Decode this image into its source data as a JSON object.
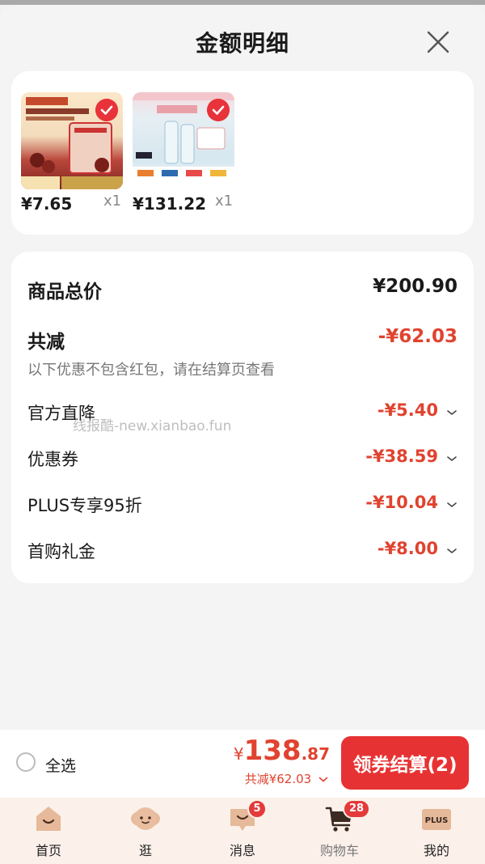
{
  "header": {
    "title": "金额明细",
    "close_icon": "close-icon"
  },
  "products": [
    {
      "price": "¥7.65",
      "qty": "x1",
      "image": "food-product-thumbnail",
      "image_colors": [
        "#8a2a22",
        "#f0d9b8"
      ],
      "selected": true
    },
    {
      "price": "¥131.22",
      "qty": "x1",
      "image": "skincare-product-thumbnail",
      "image_colors": [
        "#cfe3ee",
        "#f4c9cc"
      ],
      "selected": true
    }
  ],
  "summary": {
    "total_label": "商品总价",
    "total_value": "¥200.90",
    "discount_label": "共减",
    "discount_value": "-¥62.03",
    "note": "以下优惠不包含红包，请在结算页查看",
    "items": [
      {
        "label": "官方直降",
        "value": "-¥5.40"
      },
      {
        "label": "优惠券",
        "value": "-¥38.59"
      },
      {
        "label": "PLUS专享95折",
        "value": "-¥10.04"
      },
      {
        "label": "首购礼金",
        "value": "-¥8.00"
      }
    ]
  },
  "watermark": "线报酷-new.xianbao.fun",
  "checkout_bar": {
    "select_all": "全选",
    "currency": "¥",
    "price_int": "138",
    "price_dec": ".87",
    "reduce_text": "共减¥62.03",
    "button": "领券结算(2)"
  },
  "tabbar": {
    "tabs": [
      {
        "label": "首页",
        "icon": "home-icon"
      },
      {
        "label": "逛",
        "icon": "mascot-face-icon"
      },
      {
        "label": "消息",
        "icon": "message-icon",
        "badge": "5"
      },
      {
        "label": "购物车",
        "icon": "cart-icon",
        "badge": "28",
        "active": true
      },
      {
        "label": "我的",
        "icon": "plus-member-icon",
        "badge_text": "PLUS"
      }
    ]
  },
  "colors": {
    "accent": "#e73233",
    "price_red": "#e0432f",
    "tab_bg": "#fbf1ea"
  }
}
